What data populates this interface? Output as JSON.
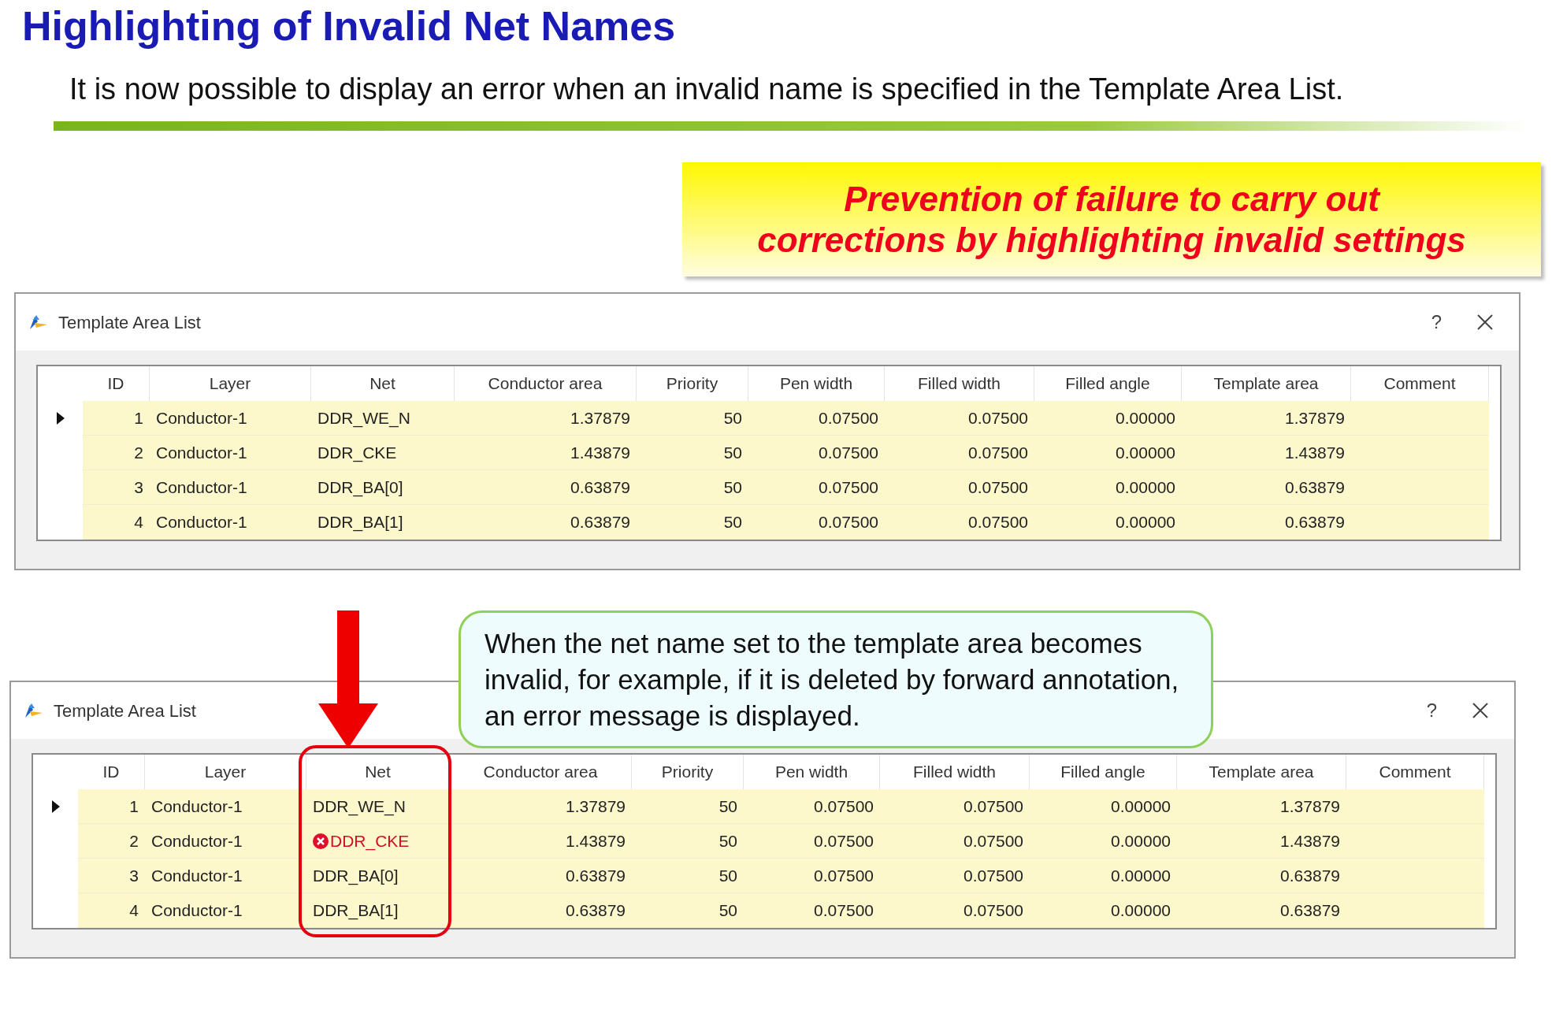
{
  "title": "Highlighting of Invalid Net Names",
  "intro": "It is now possible to display an error when an invalid name is specified in the Template Area List.",
  "callout": "Prevention of failure to carry out corrections by highlighting invalid settings",
  "note": "When the net name set to the template area becomes invalid, for example, if it is deleted by forward annotation, an error message is displayed.",
  "windows": [
    {
      "title": "Template Area List",
      "help": "?",
      "net_column_highlighted": false,
      "columns": [
        "ID",
        "Layer",
        "Net",
        "Conductor area",
        "Priority",
        "Pen width",
        "Filled width",
        "Filled angle",
        "Template area",
        "Comment"
      ],
      "rows": [
        {
          "current": true,
          "invalid": false,
          "cells": [
            "1",
            "Conductor-1",
            "DDR_WE_N",
            "1.37879",
            "50",
            "0.07500",
            "0.07500",
            "0.00000",
            "1.37879"
          ]
        },
        {
          "current": false,
          "invalid": false,
          "cells": [
            "2",
            "Conductor-1",
            "DDR_CKE",
            "1.43879",
            "50",
            "0.07500",
            "0.07500",
            "0.00000",
            "1.43879"
          ]
        },
        {
          "current": false,
          "invalid": false,
          "cells": [
            "3",
            "Conductor-1",
            "DDR_BA[0]",
            "0.63879",
            "50",
            "0.07500",
            "0.07500",
            "0.00000",
            "0.63879"
          ]
        },
        {
          "current": false,
          "invalid": false,
          "cells": [
            "4",
            "Conductor-1",
            "DDR_BA[1]",
            "0.63879",
            "50",
            "0.07500",
            "0.07500",
            "0.00000",
            "0.63879"
          ]
        }
      ]
    },
    {
      "title": "Template Area List",
      "help": "?",
      "net_column_highlighted": true,
      "columns": [
        "ID",
        "Layer",
        "Net",
        "Conductor area",
        "Priority",
        "Pen width",
        "Filled width",
        "Filled angle",
        "Template area",
        "Comment"
      ],
      "rows": [
        {
          "current": true,
          "invalid": false,
          "cells": [
            "1",
            "Conductor-1",
            "DDR_WE_N",
            "1.37879",
            "50",
            "0.07500",
            "0.07500",
            "0.00000",
            "1.37879"
          ]
        },
        {
          "current": false,
          "invalid": true,
          "cells": [
            "2",
            "Conductor-1",
            "DDR_CKE",
            "1.43879",
            "50",
            "0.07500",
            "0.07500",
            "0.00000",
            "1.43879"
          ]
        },
        {
          "current": false,
          "invalid": false,
          "cells": [
            "3",
            "Conductor-1",
            "DDR_BA[0]",
            "0.63879",
            "50",
            "0.07500",
            "0.07500",
            "0.00000",
            "0.63879"
          ]
        },
        {
          "current": false,
          "invalid": false,
          "cells": [
            "4",
            "Conductor-1",
            "DDR_BA[1]",
            "0.63879",
            "50",
            "0.07500",
            "0.07500",
            "0.00000",
            "0.63879"
          ]
        }
      ]
    }
  ]
}
